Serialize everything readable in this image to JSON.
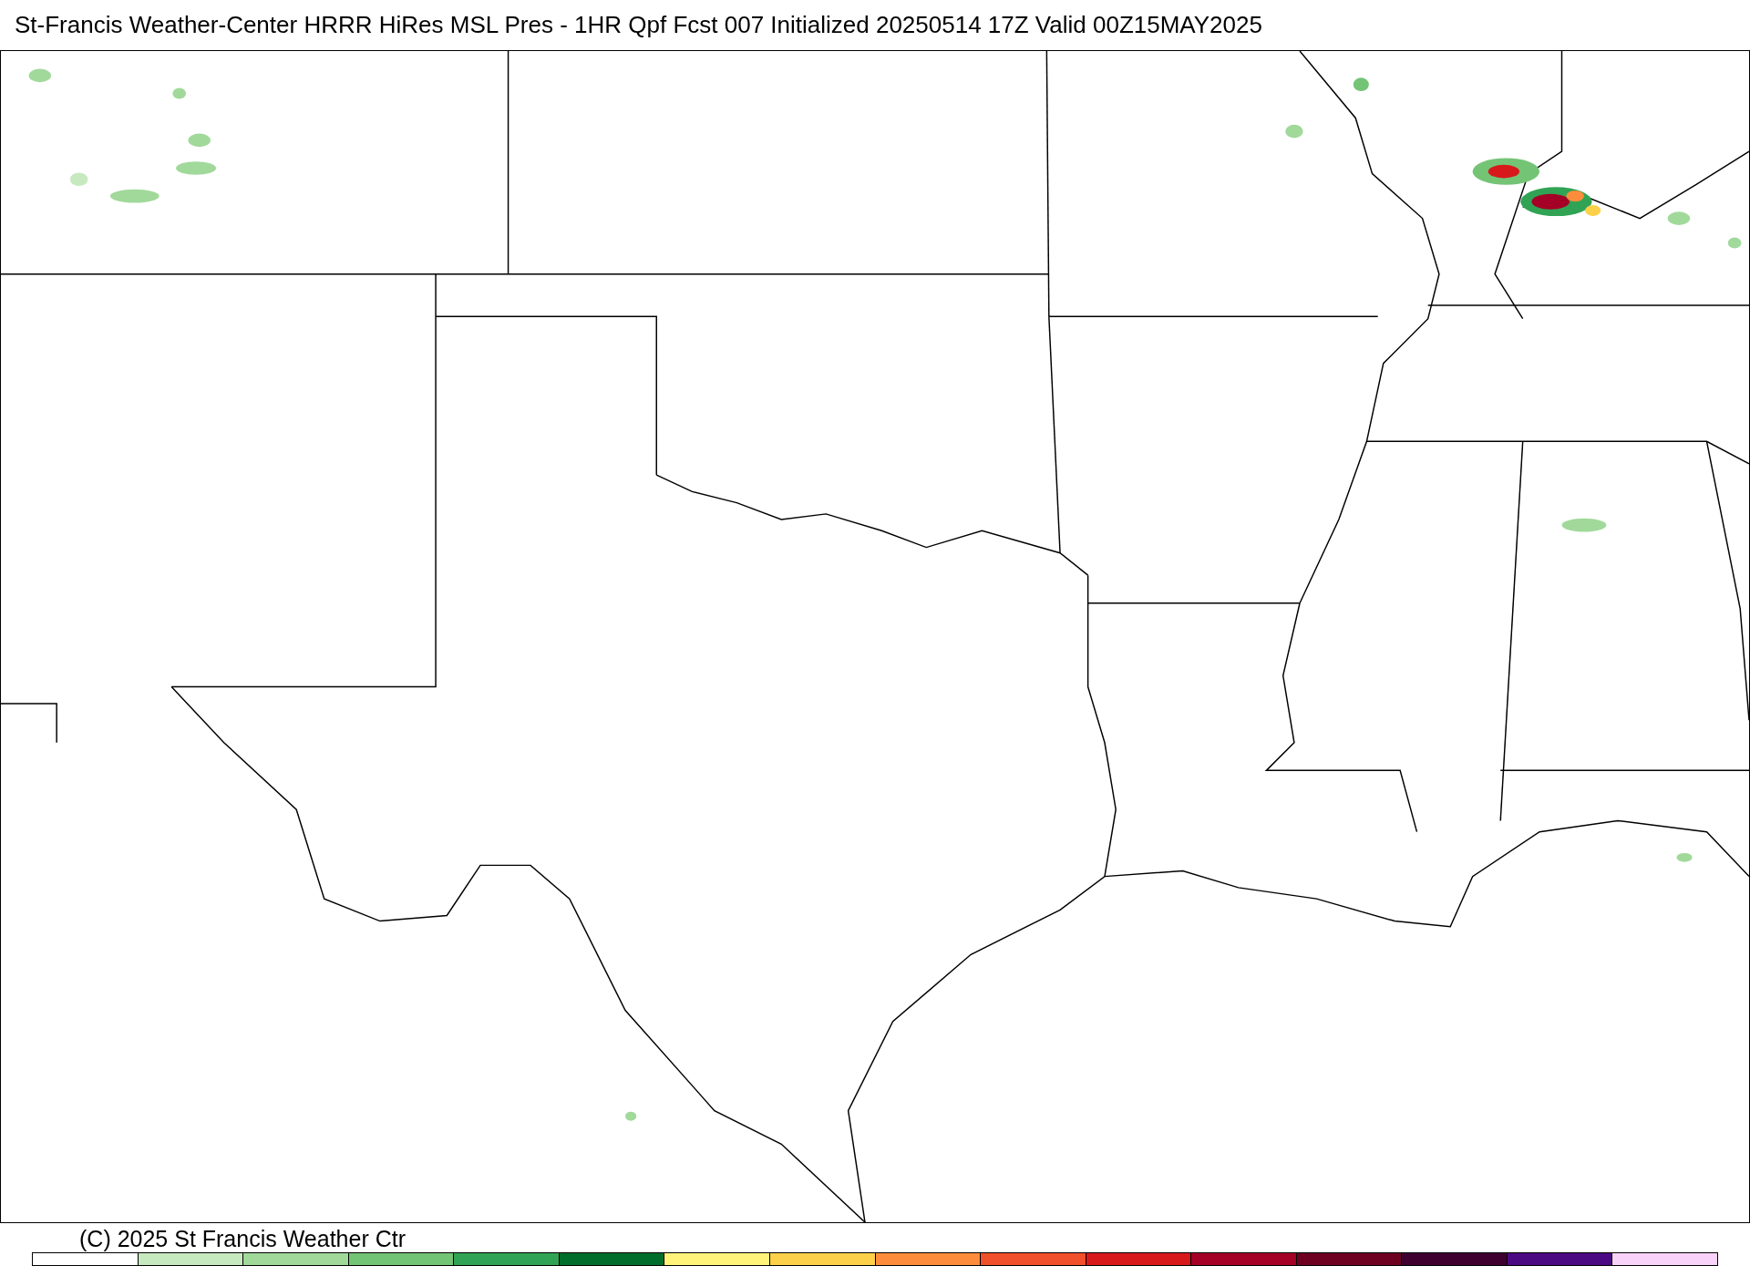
{
  "title": "St-Francis Weather-Center HRRR HiRes MSL Pres - 1HR Qpf Fcst 007 Initialized 20250514 17Z Valid 00Z15MAY2025",
  "copyright": "(C) 2025 St Francis Weather Ctr",
  "legend": {
    "swatches": [
      {
        "color": "#ffffff"
      },
      {
        "color": "#c7e9c0"
      },
      {
        "color": "#a1d99b"
      },
      {
        "color": "#74c476"
      },
      {
        "color": "#31a354"
      },
      {
        "color": "#006d2c"
      },
      {
        "color": "#fff37a"
      },
      {
        "color": "#fdd049"
      },
      {
        "color": "#fd8d3c"
      },
      {
        "color": "#f0502b"
      },
      {
        "color": "#d7191c"
      },
      {
        "color": "#a50026"
      },
      {
        "color": "#6e0022"
      },
      {
        "color": "#3f0030"
      },
      {
        "color": "#4b0a82"
      },
      {
        "color": "#f8d2f8"
      }
    ]
  }
}
